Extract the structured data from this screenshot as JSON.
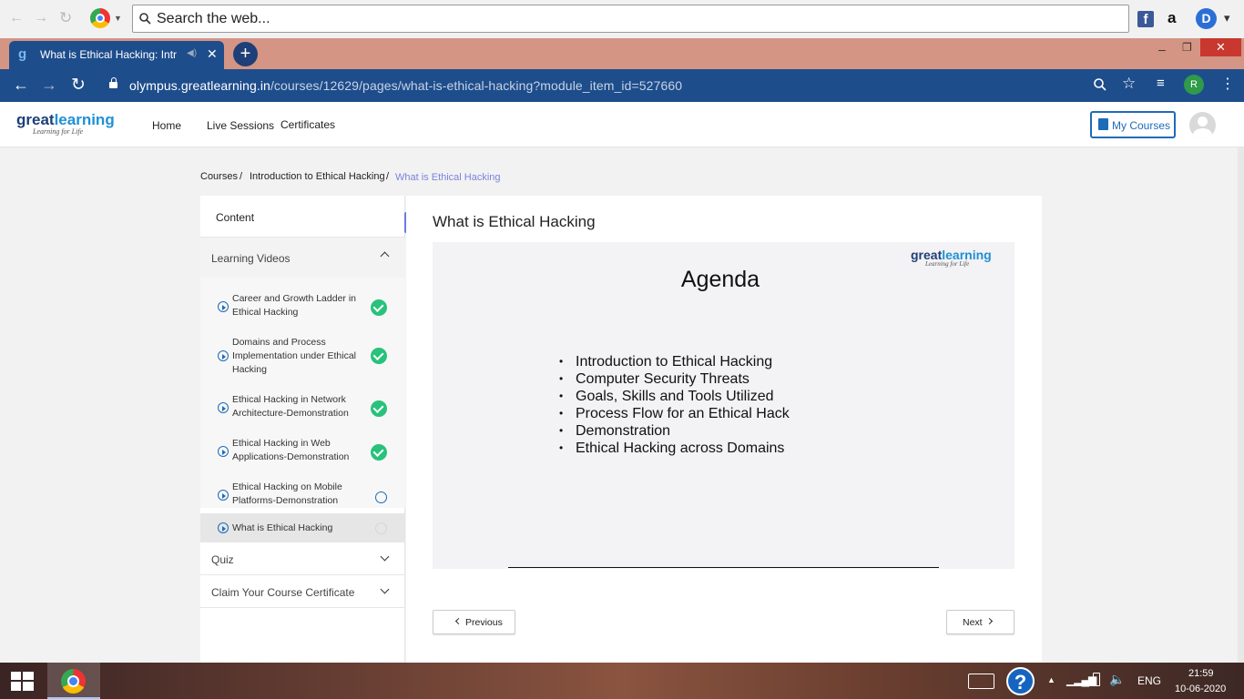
{
  "browser": {
    "search_placeholder": "Search the web...",
    "tab_title": "What is Ethical Hacking: Intro",
    "url_host": "olympus.greatlearning.in",
    "url_path": "/courses/12629/pages/what-is-ethical-hacking?module_item_id=527660",
    "profile_initial": "R",
    "ext_d": "D",
    "ext_a": "a",
    "ext_f": "f"
  },
  "header": {
    "logo_great": "great",
    "logo_learning": "learning",
    "logo_tagline": "Learning for Life",
    "nav": [
      "Home",
      "Live Sessions",
      "Certificates"
    ],
    "my_courses": "My Courses"
  },
  "breadcrumb": {
    "items": [
      "Courses",
      "Introduction to Ethical Hacking",
      "What is Ethical Hacking"
    ],
    "separator": "/"
  },
  "sidebar": {
    "content_label": "Content",
    "sections": {
      "learning_videos": "Learning Videos",
      "quiz": "Quiz",
      "claim": "Claim Your Course Certificate"
    },
    "lessons": [
      {
        "label": "Career and Growth Ladder in Ethical Hacking",
        "status": "complete"
      },
      {
        "label": "Domains and Process Implementation under Ethical Hacking",
        "status": "complete"
      },
      {
        "label": "Ethical Hacking in Network Architecture-Demonstration",
        "status": "complete"
      },
      {
        "label": "Ethical Hacking in Web Applications-Demonstration",
        "status": "complete"
      },
      {
        "label": "Ethical Hacking on Mobile Platforms-Demonstration",
        "status": "incomplete"
      },
      {
        "label": "What is Ethical Hacking",
        "status": "current"
      }
    ]
  },
  "main": {
    "page_title": "What is Ethical Hacking",
    "slide": {
      "heading": "Agenda",
      "bullets": [
        "Introduction to Ethical Hacking",
        "Computer Security Threats",
        "Goals, Skills and Tools Utilized",
        "Process Flow for an Ethical Hack",
        "Demonstration",
        "Ethical Hacking across Domains"
      ]
    },
    "prev_label": "Previous",
    "next_label": "Next"
  },
  "taskbar": {
    "time": "21:59",
    "date": "10-06-2020",
    "language": "ENG"
  },
  "colors": {
    "brand_blue": "#1e4d8c",
    "accent": "#1e6bb8",
    "tab_bar": "#d49585",
    "complete_green": "#28c27a",
    "collapse_btn": "#6c7ae0"
  }
}
